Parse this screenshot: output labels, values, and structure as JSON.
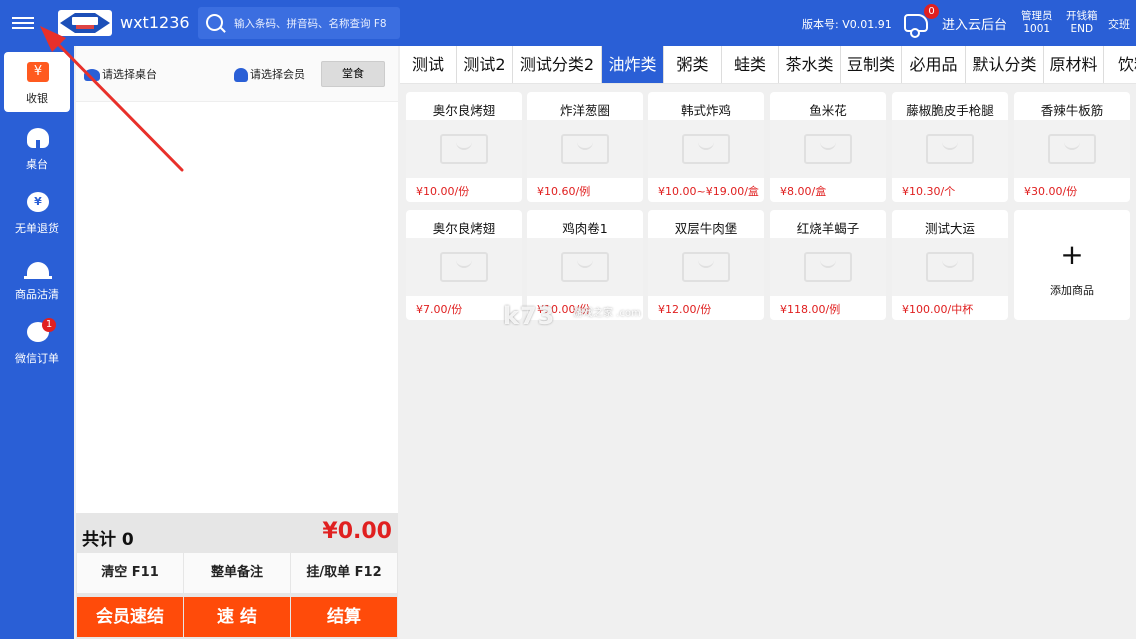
{
  "topbar": {
    "store_name": "wxt1236",
    "search_placeholder": "输入条码、拼音码、名称查询 F8",
    "version": "版本号: V0.01.91",
    "notification_count": "0",
    "cloud_label": "进入云后台",
    "manager_line1": "管理员",
    "manager_line2": "1001",
    "drawer_line1": "开钱箱",
    "drawer_line2": "END",
    "shift_label": "交班"
  },
  "leftnav": {
    "items": [
      {
        "label": "收银",
        "icon": "yen-icon"
      },
      {
        "label": "桌台",
        "icon": "table-icon"
      },
      {
        "label": "无单退货",
        "icon": "return-icon"
      },
      {
        "label": "商品沽清",
        "icon": "service-bell-icon"
      },
      {
        "label": "微信订单",
        "icon": "wechat-icon",
        "badge": "1"
      }
    ]
  },
  "order": {
    "table_select": "请选择桌台",
    "member_select": "请选择会员",
    "dine_mode": "堂食",
    "total_label": "共计 0",
    "total_amount": "¥0.00",
    "btn_clear": "清空 F11",
    "btn_note": "整单备注",
    "btn_hold": "挂/取单 F12",
    "btn_member_quick": "会员速结",
    "btn_quick": "速 结",
    "btn_checkout": "结算"
  },
  "categories": [
    "测试",
    "测试2",
    "测试分类2",
    "油炸类",
    "粥类",
    "蛙类",
    "茶水类",
    "豆制类",
    "必用品",
    "默认分类",
    "原材料",
    "饮料"
  ],
  "active_category": "油炸类",
  "products": [
    {
      "name": "奥尔良烤翅",
      "price": "¥10.00/份"
    },
    {
      "name": "炸洋葱圈",
      "price": "¥10.60/例"
    },
    {
      "name": "韩式炸鸡",
      "price": "¥10.00~¥19.00/盒"
    },
    {
      "name": "鱼米花",
      "price": "¥8.00/盒"
    },
    {
      "name": "藤椒脆皮手枪腿",
      "price": "¥10.30/个"
    },
    {
      "name": "香辣牛板筋",
      "price": "¥30.00/份"
    },
    {
      "name": "奥尔良烤翅",
      "price": "¥7.00/份"
    },
    {
      "name": "鸡肉卷1",
      "price": "¥10.00/份"
    },
    {
      "name": "双层牛肉堡",
      "price": "¥12.00/份"
    },
    {
      "name": "红烧羊蝎子",
      "price": "¥118.00/例"
    },
    {
      "name": "测试大运",
      "price": "¥100.00/中杯"
    }
  ],
  "add_product_label": "添加商品",
  "watermark": {
    "main": "k73",
    "sub": "游戏之家 .com"
  },
  "colors": {
    "primary": "#2a5fd6",
    "accent": "#ff4b0a",
    "price": "#e02020"
  }
}
